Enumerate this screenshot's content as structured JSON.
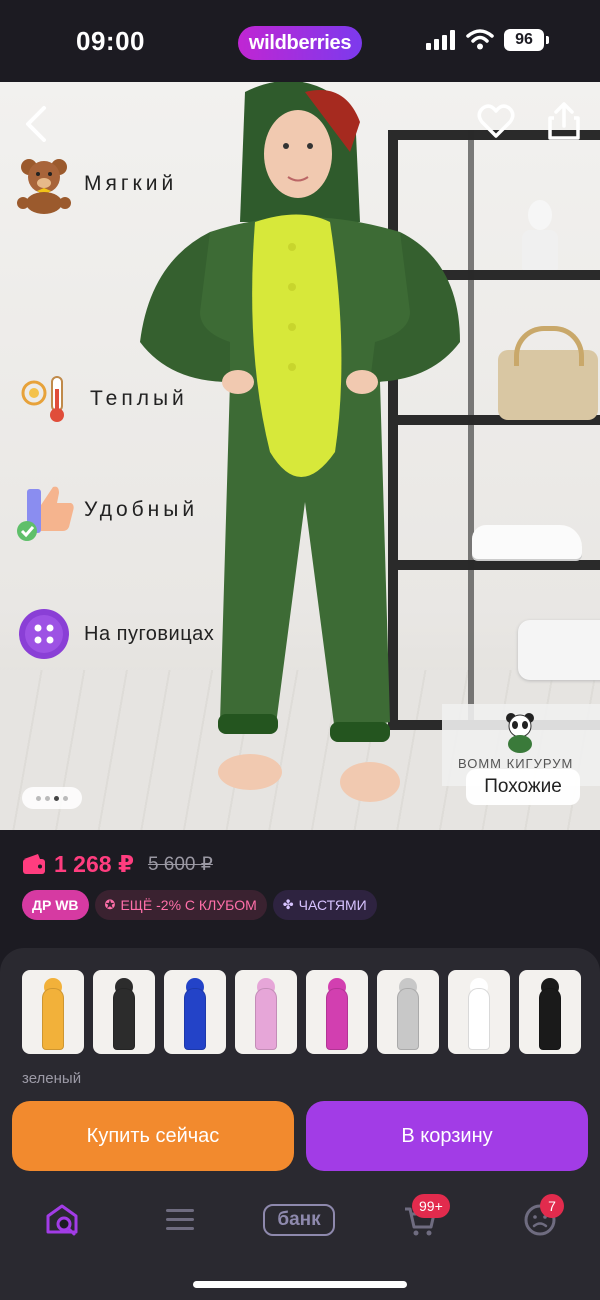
{
  "status_bar": {
    "time": "09:00",
    "app_badge": "wildberries",
    "battery": "96"
  },
  "photo": {
    "features": [
      {
        "label": "Мягкий",
        "icon": "teddy-bear-icon"
      },
      {
        "label": "Теплый",
        "icon": "thermometer-icon"
      },
      {
        "label": "Удобный",
        "icon": "thumbs-up-icon"
      },
      {
        "label": "На пуговицах",
        "icon": "button-icon"
      }
    ],
    "similar_brand": "ВОММ КИГУРУМ",
    "similar_label": "Похожие",
    "slide_count": 4,
    "active_slide": 3
  },
  "price": {
    "current": "1 268 ₽",
    "old": "5 600 ₽",
    "accent_color": "#ff3d7f"
  },
  "badges": {
    "dr": "ДР WB",
    "club": "ЕЩЁ -2% С КЛУБОМ",
    "parts": "ЧАСТЯМИ"
  },
  "variants": [
    {
      "color": "#f2b13a"
    },
    {
      "color": "#2c2c2c"
    },
    {
      "color": "#2343c8"
    },
    {
      "color": "#e6a6d8"
    },
    {
      "color": "#d23fb0"
    },
    {
      "color": "#c8c8c8"
    },
    {
      "color": "#ffffff"
    },
    {
      "color": "#1a1a1a"
    }
  ],
  "color_label": "зеленый",
  "actions": {
    "buy_now": "Купить сейчас",
    "add_to_cart": "В корзину"
  },
  "nav": {
    "bank": "банк",
    "cart_count": "99+",
    "profile_count": "7"
  }
}
